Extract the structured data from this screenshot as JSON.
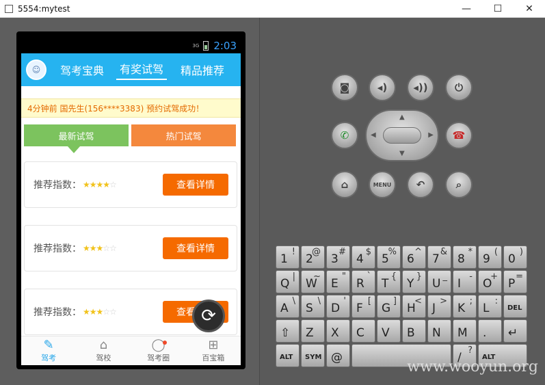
{
  "window": {
    "title": "5554:mytest",
    "min": "—",
    "max": "☐",
    "close": "✕"
  },
  "statusbar": {
    "signal": "3G",
    "time": "2:03"
  },
  "app": {
    "tabs": [
      {
        "label": "驾考宝典"
      },
      {
        "label": "有奖试驾"
      },
      {
        "label": "精品推荐"
      }
    ],
    "notice": "4分钟前 国先生(156****3383) 预约试驾成功！",
    "segments": [
      {
        "label": "最新试驾"
      },
      {
        "label": "热门试驾"
      }
    ],
    "cards": [
      {
        "label": "推荐指数：",
        "rating": 4,
        "button": "查看详情"
      },
      {
        "label": "推荐指数：",
        "rating": 3,
        "button": "查看详情"
      },
      {
        "label": "推荐指数：",
        "rating": 3,
        "button": "查看详情"
      }
    ],
    "bottom_nav": [
      {
        "label": "驾考"
      },
      {
        "label": "驾校"
      },
      {
        "label": "驾考圈"
      },
      {
        "label": "百宝箱"
      }
    ]
  },
  "hardware": {
    "menu_label": "MENU"
  },
  "keyboard": {
    "rows": [
      [
        [
          "1",
          "!"
        ],
        [
          "2",
          "@"
        ],
        [
          "3",
          "#"
        ],
        [
          "4",
          "$"
        ],
        [
          "5",
          "%"
        ],
        [
          "6",
          "^"
        ],
        [
          "7",
          "&"
        ],
        [
          "8",
          "*"
        ],
        [
          "9",
          "("
        ],
        [
          "0",
          ")"
        ]
      ],
      [
        [
          "Q",
          "|"
        ],
        [
          "W",
          "~"
        ],
        [
          "E",
          "\""
        ],
        [
          "R",
          "`"
        ],
        [
          "T",
          "{"
        ],
        [
          "Y",
          "}"
        ],
        [
          "U",
          "_"
        ],
        [
          "I",
          "-"
        ],
        [
          "O",
          "+"
        ],
        [
          "P",
          "="
        ]
      ],
      [
        [
          "A",
          "\\"
        ],
        [
          "S",
          "\\"
        ],
        [
          "D",
          "'"
        ],
        [
          "F",
          "["
        ],
        [
          "G",
          "]"
        ],
        [
          "H",
          "<"
        ],
        [
          "J",
          ">"
        ],
        [
          "K",
          ";"
        ],
        [
          "L",
          ":"
        ],
        [
          "DEL",
          ""
        ]
      ],
      [
        [
          "⇧",
          ""
        ],
        [
          "Z",
          ""
        ],
        [
          "X",
          ""
        ],
        [
          "C",
          ""
        ],
        [
          "V",
          ""
        ],
        [
          "B",
          ""
        ],
        [
          "N",
          ""
        ],
        [
          "M",
          ""
        ],
        [
          ".",
          ""
        ],
        [
          "↵",
          ""
        ]
      ],
      [
        [
          "ALT",
          ""
        ],
        [
          "SYM",
          ""
        ],
        [
          "@",
          ""
        ],
        [
          "",
          ""
        ],
        [
          "/",
          "?"
        ],
        [
          "ALT",
          ""
        ]
      ]
    ]
  },
  "watermark": "www.wooyun.org"
}
